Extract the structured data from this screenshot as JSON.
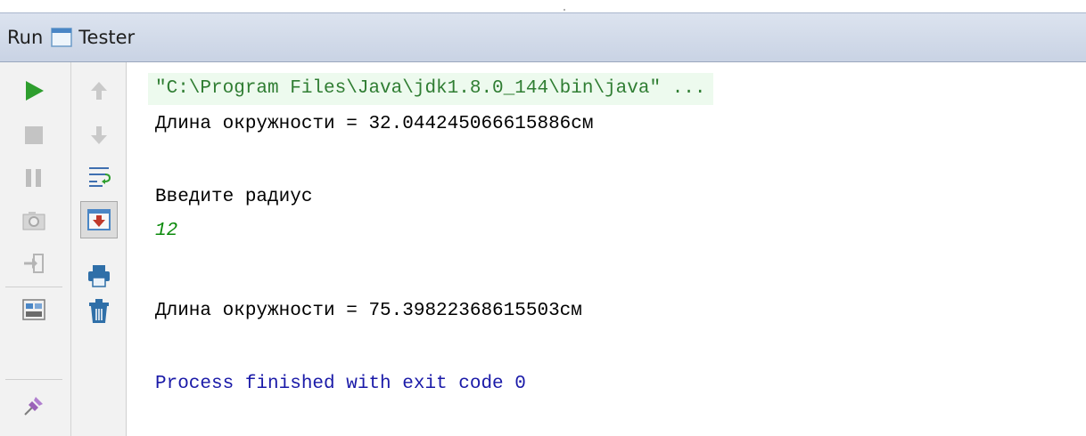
{
  "titlebar": {
    "run_label": "Run",
    "tab_label": "Tester"
  },
  "toolbar_left": [
    {
      "name": "rerun",
      "icon": "play-icon",
      "color": "#2e9e2e"
    },
    {
      "name": "stop",
      "icon": "stop-icon",
      "color": "#b3b3b3"
    },
    {
      "name": "pause",
      "icon": "pause-icon",
      "color": "#b3b3b3"
    },
    {
      "name": "dump-threads",
      "icon": "camera-icon",
      "color": "#b3b3b3"
    },
    {
      "name": "exit",
      "icon": "exit-icon",
      "color": "#b3b3b3"
    },
    {
      "name": "layout",
      "icon": "layout-icon",
      "color": "#7a7a7a"
    },
    {
      "name": "pin",
      "icon": "pin-icon",
      "color": "#8b5aa8"
    }
  ],
  "toolbar_right": [
    {
      "name": "up",
      "icon": "arrow-up-icon"
    },
    {
      "name": "down",
      "icon": "arrow-down-icon"
    },
    {
      "name": "soft-wrap",
      "icon": "soft-wrap-icon"
    },
    {
      "name": "scroll-to-end",
      "icon": "scroll-to-end-icon"
    },
    {
      "name": "print",
      "icon": "print-icon"
    },
    {
      "name": "clear",
      "icon": "trash-icon"
    }
  ],
  "console": {
    "command": "\"C:\\Program Files\\Java\\jdk1.8.0_144\\bin\\java\" ...",
    "line1": "Длина окружности = 32.044245066615886см",
    "prompt": "Введите радиус",
    "user_input": "12",
    "line2": "Длина окружности = 75.39822368615503см",
    "exit": "Process finished with exit code 0"
  }
}
